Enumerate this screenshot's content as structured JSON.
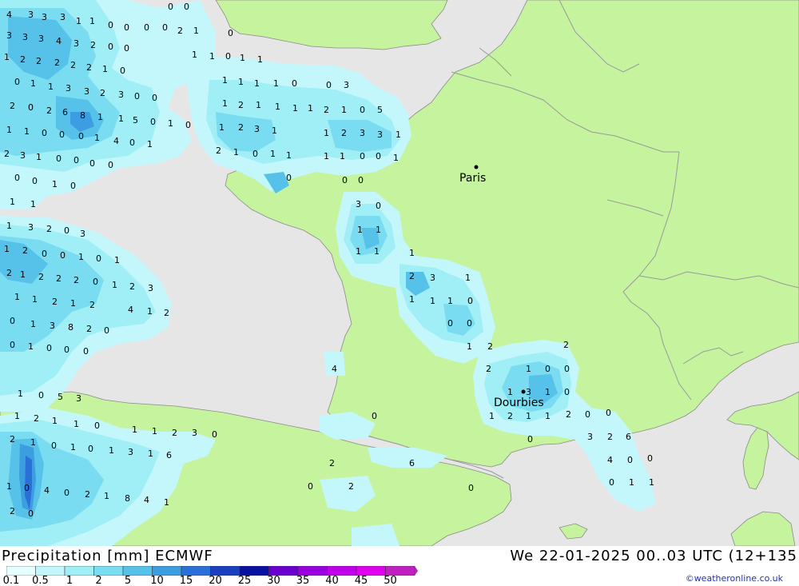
{
  "title": "Precipitation [mm] ECMWF",
  "datetime": "We 22-01-2025 00..03 UTC (12+135",
  "credit": "©weatheronline.co.uk",
  "legend": {
    "labels": [
      "0.1",
      "0.5",
      "1",
      "2",
      "5",
      "10",
      "15",
      "20",
      "25",
      "30",
      "35",
      "40",
      "45",
      "50"
    ],
    "colors": [
      "#e6ffff",
      "#c4f7fb",
      "#a0eef6",
      "#7adcf0",
      "#56c2ea",
      "#3c9ee0",
      "#2a70d8",
      "#1a40c0",
      "#0a10a0",
      "#6a00d0",
      "#9800e0",
      "#c000e8",
      "#e000f0",
      "#c020c0"
    ]
  },
  "colors": {
    "sea": "#e6e6e6",
    "land": "#c6f39e",
    "border": "#9a9a9a",
    "coast": "#8a8a8a"
  },
  "cities": [
    {
      "name": "Paris"
    },
    {
      "name": "Dourbies"
    }
  ],
  "values": [
    "4",
    "3",
    "3",
    "3",
    "1",
    "1",
    "0",
    "0",
    "0",
    "0",
    "2",
    "1",
    "0",
    "0",
    "0",
    "3",
    "3",
    "3",
    "4",
    "3",
    "2",
    "0",
    "0",
    "1",
    "2",
    "2",
    "2",
    "2",
    "2",
    "1",
    "0",
    "1",
    "1",
    "0",
    "1",
    "1",
    "0",
    "1",
    "1",
    "3",
    "3",
    "2",
    "3",
    "0",
    "0",
    "1",
    "1",
    "1",
    "1",
    "0",
    "0",
    "3",
    "2",
    "0",
    "2",
    "6",
    "8",
    "1",
    "1",
    "5",
    "0",
    "1",
    "0",
    "1",
    "2",
    "1",
    "1",
    "1",
    "1",
    "2",
    "1",
    "0",
    "5",
    "1",
    "1",
    "0",
    "0",
    "0",
    "1",
    "4",
    "0",
    "1",
    "1",
    "2",
    "3",
    "1",
    "1",
    "2",
    "3",
    "3",
    "1",
    "2",
    "3",
    "1",
    "0",
    "0",
    "0",
    "0",
    "2",
    "1",
    "0",
    "1",
    "1",
    "1",
    "1",
    "0",
    "0",
    "1",
    "0",
    "0",
    "1",
    "0",
    "0",
    "0",
    "0",
    "1",
    "1",
    "1",
    "3",
    "2",
    "0",
    "3",
    "3",
    "0",
    "1",
    "1",
    "1",
    "1",
    "1",
    "1",
    "2",
    "0",
    "0",
    "1",
    "0",
    "1",
    "2",
    "1",
    "2",
    "2",
    "2",
    "0",
    "1",
    "2",
    "3",
    "2",
    "3",
    "1",
    "1",
    "1",
    "2",
    "1",
    "2",
    "4",
    "1",
    "2",
    "1",
    "1",
    "1",
    "0",
    "0",
    "0",
    "0",
    "1",
    "3",
    "8",
    "2",
    "0",
    "0",
    "1",
    "0",
    "0",
    "0",
    "1",
    "2",
    "4",
    "2",
    "1",
    "0",
    "5",
    "3",
    "1",
    "0",
    "0",
    "1",
    "3",
    "1",
    "0",
    "2",
    "1",
    "2",
    "1",
    "1",
    "0",
    "0",
    "1",
    "2",
    "1",
    "1",
    "2",
    "0",
    "0",
    "2",
    "1",
    "0",
    "1",
    "0",
    "1",
    "3",
    "1",
    "6",
    "1",
    "1",
    "2",
    "3",
    "0",
    "0",
    "3",
    "2",
    "6",
    "2",
    "6",
    "1",
    "0",
    "4",
    "0",
    "2",
    "1",
    "8",
    "4",
    "1",
    "4",
    "0",
    "0",
    "0",
    "2",
    "0",
    "0",
    "1",
    "1",
    "2",
    "0"
  ]
}
